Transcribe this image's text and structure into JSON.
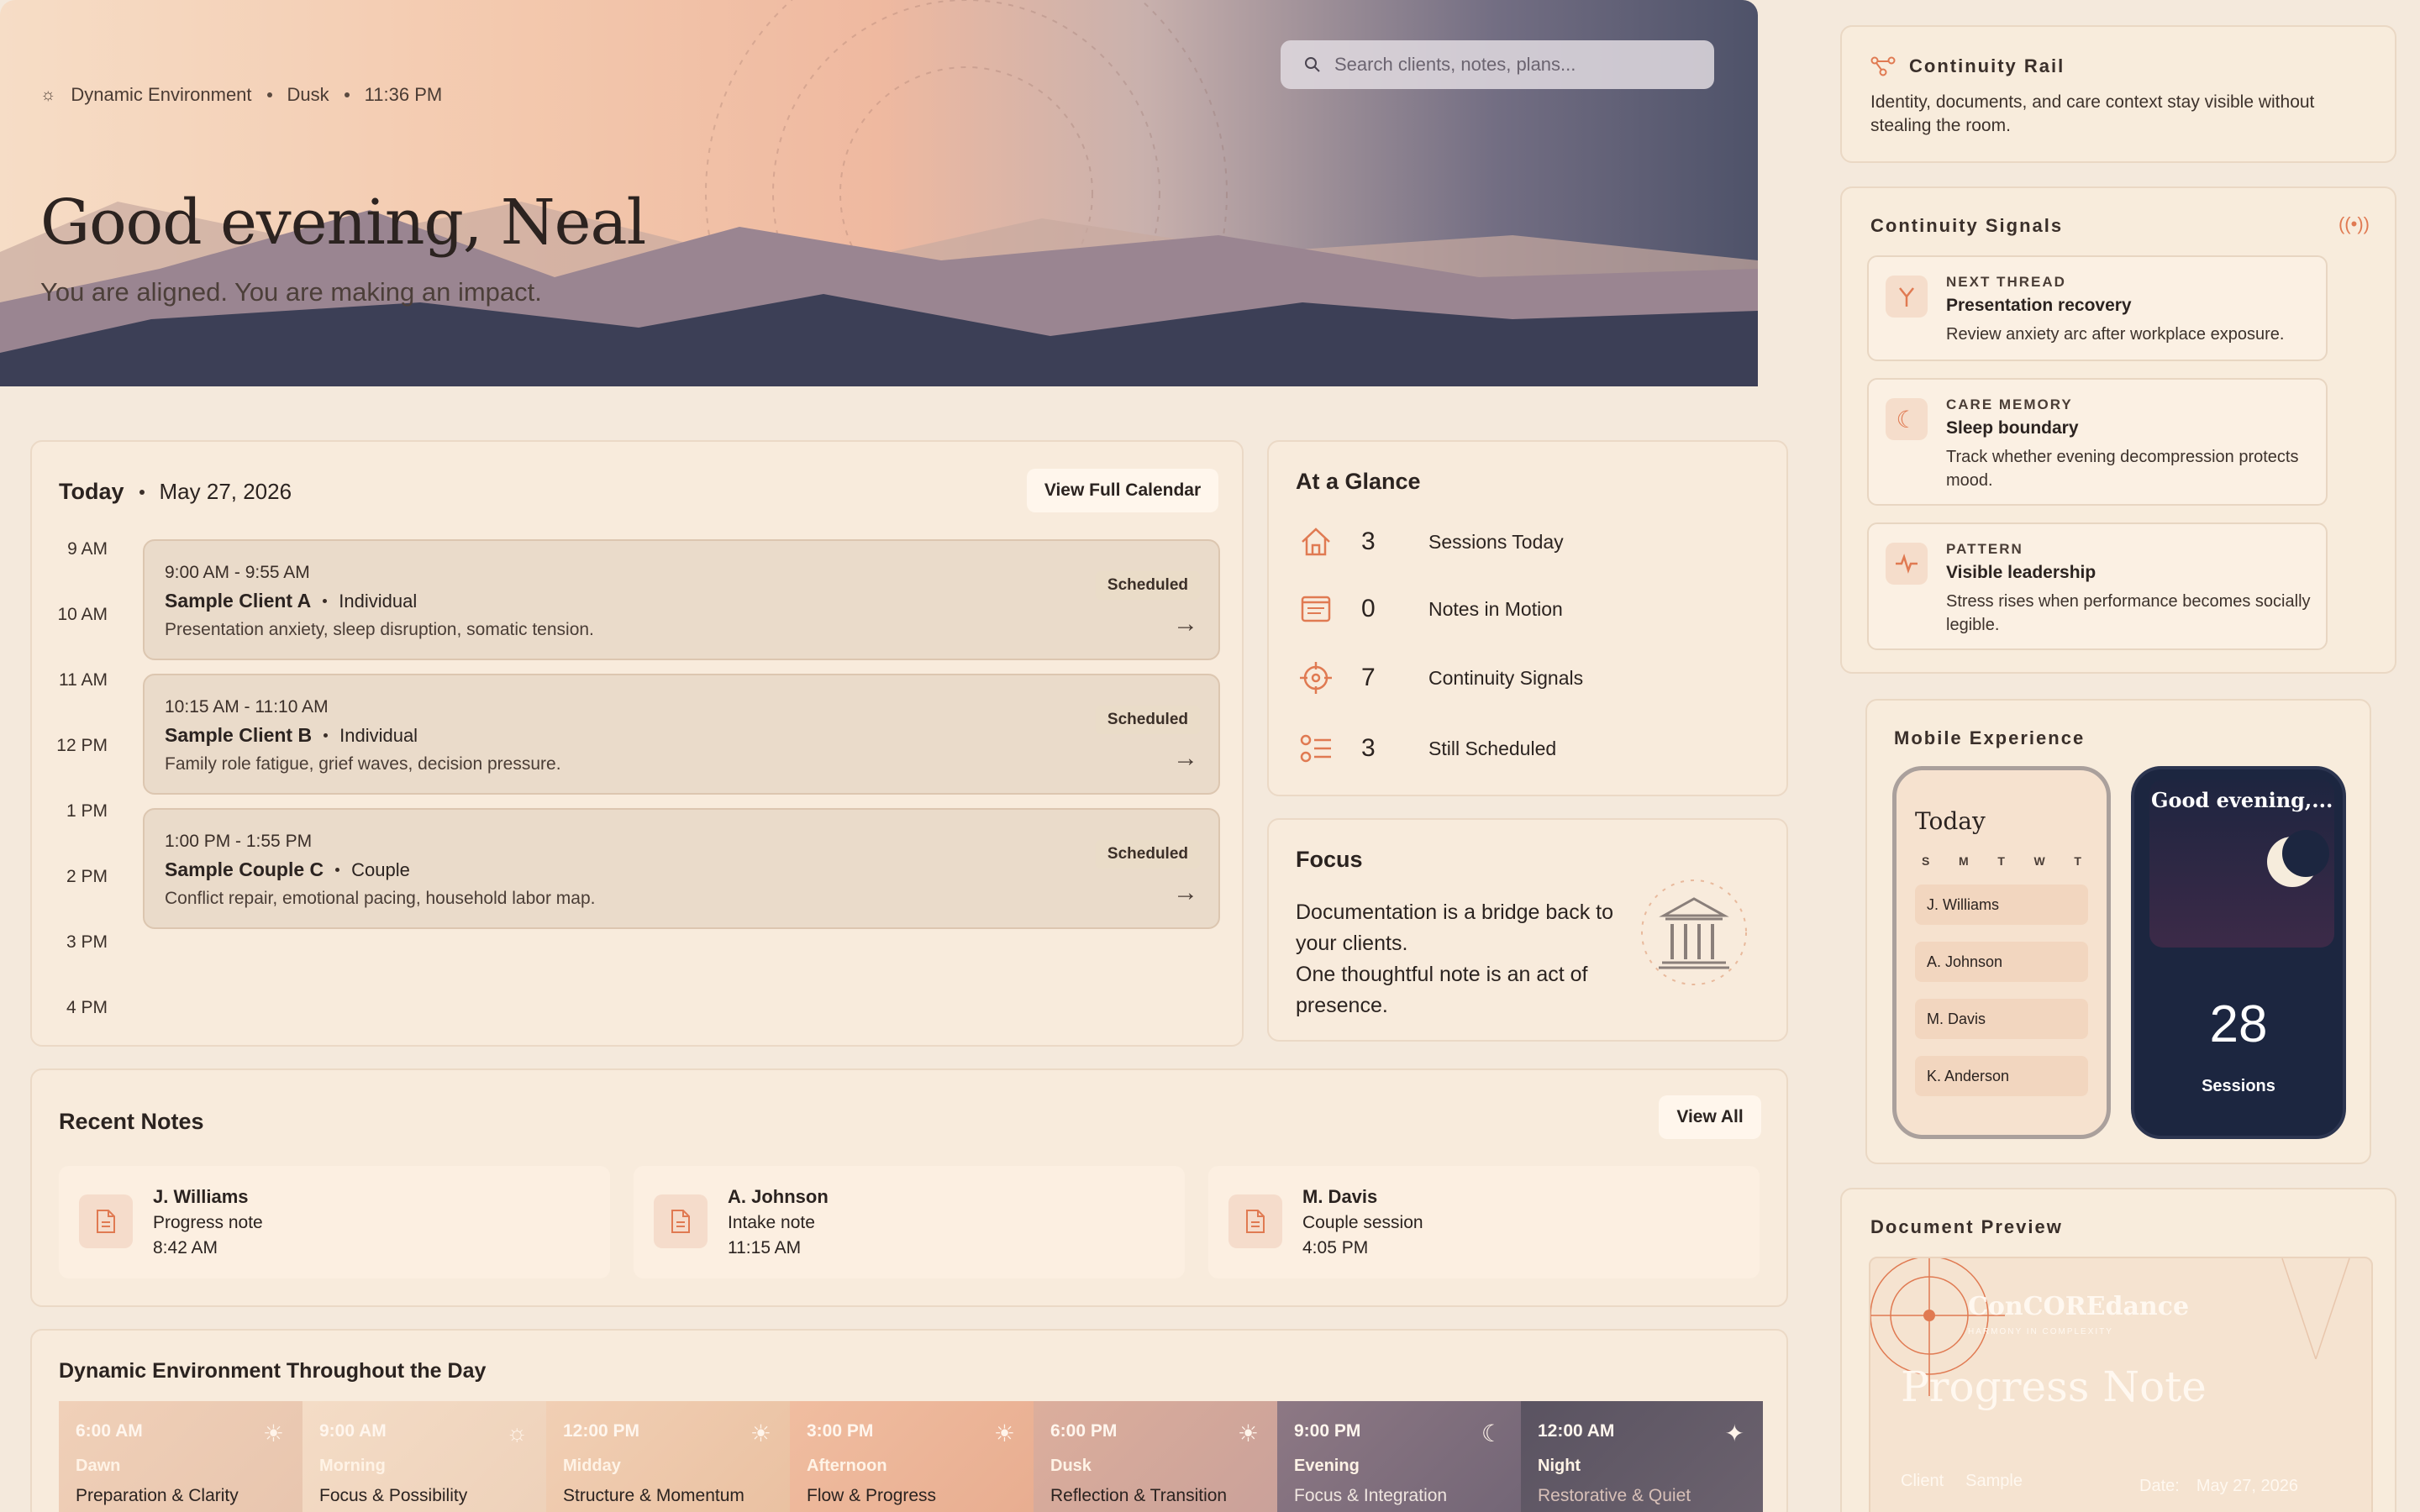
{
  "hero": {
    "env_label": "Dynamic Environment",
    "period": "Dusk",
    "time": "11:36 PM",
    "search_placeholder": "Search clients, notes, plans...",
    "greeting": "Good evening, Neal",
    "tagline": "You are aligned. You are making an impact."
  },
  "today": {
    "title": "Today",
    "date": "May 27, 2026",
    "calendar_button": "View Full Calendar",
    "hours": [
      "9 AM",
      "10 AM",
      "11 AM",
      "12 PM",
      "1 PM",
      "2 PM",
      "3 PM",
      "4 PM"
    ],
    "appointments": [
      {
        "time": "9:00 AM - 9:55 AM",
        "client": "Sample Client A",
        "type": "Individual",
        "desc": "Presentation anxiety, sleep disruption, somatic tension.",
        "status": "Scheduled"
      },
      {
        "time": "10:15 AM - 11:10 AM",
        "client": "Sample Client B",
        "type": "Individual",
        "desc": "Family role fatigue, grief waves, decision pressure.",
        "status": "Scheduled"
      },
      {
        "time": "1:00 PM - 1:55 PM",
        "client": "Sample Couple C",
        "type": "Couple",
        "desc": "Conflict repair, emotional pacing, household labor map.",
        "status": "Scheduled"
      }
    ]
  },
  "glance": {
    "title": "At a Glance",
    "items": [
      {
        "value": "3",
        "label": "Sessions Today",
        "icon": "home-icon"
      },
      {
        "value": "0",
        "label": "Notes in Motion",
        "icon": "notes-icon"
      },
      {
        "value": "7",
        "label": "Continuity Signals",
        "icon": "crosshair-icon"
      },
      {
        "value": "3",
        "label": "Still Scheduled",
        "icon": "checklist-icon"
      }
    ]
  },
  "focus": {
    "title": "Focus",
    "text1": "Documentation is a bridge back to your clients.",
    "text2": "One thoughtful note is an act of presence."
  },
  "notes": {
    "title": "Recent Notes",
    "view_all": "View All",
    "items": [
      {
        "name": "J. Williams",
        "type": "Progress note",
        "time": "8:42 AM"
      },
      {
        "name": "A. Johnson",
        "type": "Intake note",
        "time": "11:15 AM"
      },
      {
        "name": "M. Davis",
        "type": "Couple session",
        "time": "4:05 PM"
      }
    ]
  },
  "dynamic": {
    "title": "Dynamic Environment Throughout the Day",
    "segments": [
      {
        "time": "6:00 AM",
        "name": "Dawn",
        "desc": "Preparation & Clarity",
        "bg": "#f0d3bd"
      },
      {
        "time": "9:00 AM",
        "name": "Morning",
        "desc": "Focus & Possibility",
        "bg": "#f2d8c2"
      },
      {
        "time": "12:00 PM",
        "name": "Midday",
        "desc": "Structure & Momentum",
        "bg": "#f0c9ac"
      },
      {
        "time": "3:00 PM",
        "name": "Afternoon",
        "desc": "Flow & Progress",
        "bg": "#eeb79c"
      },
      {
        "time": "6:00 PM",
        "name": "Dusk",
        "desc": "Reflection & Transition",
        "bg": "#d9aa9b"
      },
      {
        "time": "9:00 PM",
        "name": "Evening",
        "desc": "Focus & Integration",
        "bg": "#8a7683"
      },
      {
        "time": "12:00 AM",
        "name": "Night",
        "desc": "Restorative & Quiet",
        "bg": "#5e5661"
      }
    ]
  },
  "rail": {
    "title": "Continuity Rail",
    "desc": "Identity, documents, and care context stay visible without stealing the room."
  },
  "signals": {
    "title": "Continuity Signals",
    "items": [
      {
        "kind": "NEXT THREAD",
        "head": "Presentation recovery",
        "body": "Review anxiety arc after workplace exposure."
      },
      {
        "kind": "CARE MEMORY",
        "head": "Sleep boundary",
        "body": "Track whether evening decompression protects mood."
      },
      {
        "kind": "PATTERN",
        "head": "Visible leadership",
        "body": "Stress rises when performance becomes socially legible."
      }
    ]
  },
  "mobile": {
    "title": "Mobile Experience",
    "phone_title": "Today",
    "days": [
      "S",
      "M",
      "T",
      "W",
      "T"
    ],
    "clients": [
      "J. Williams",
      "A. Johnson",
      "M. Davis",
      "K. Anderson"
    ],
    "dark_greeting": "Good evening,...",
    "sessions_count": "28",
    "sessions_label": "Sessions"
  },
  "doc": {
    "title": "Document Preview",
    "brand": "ConCOREdance",
    "brand_sub": "HARMONY IN COMPLEXITY",
    "heading": "Progress Note",
    "client_label": "Client",
    "client_value": "Sample",
    "date_label": "Date:",
    "date_value": "May 27, 2026"
  }
}
